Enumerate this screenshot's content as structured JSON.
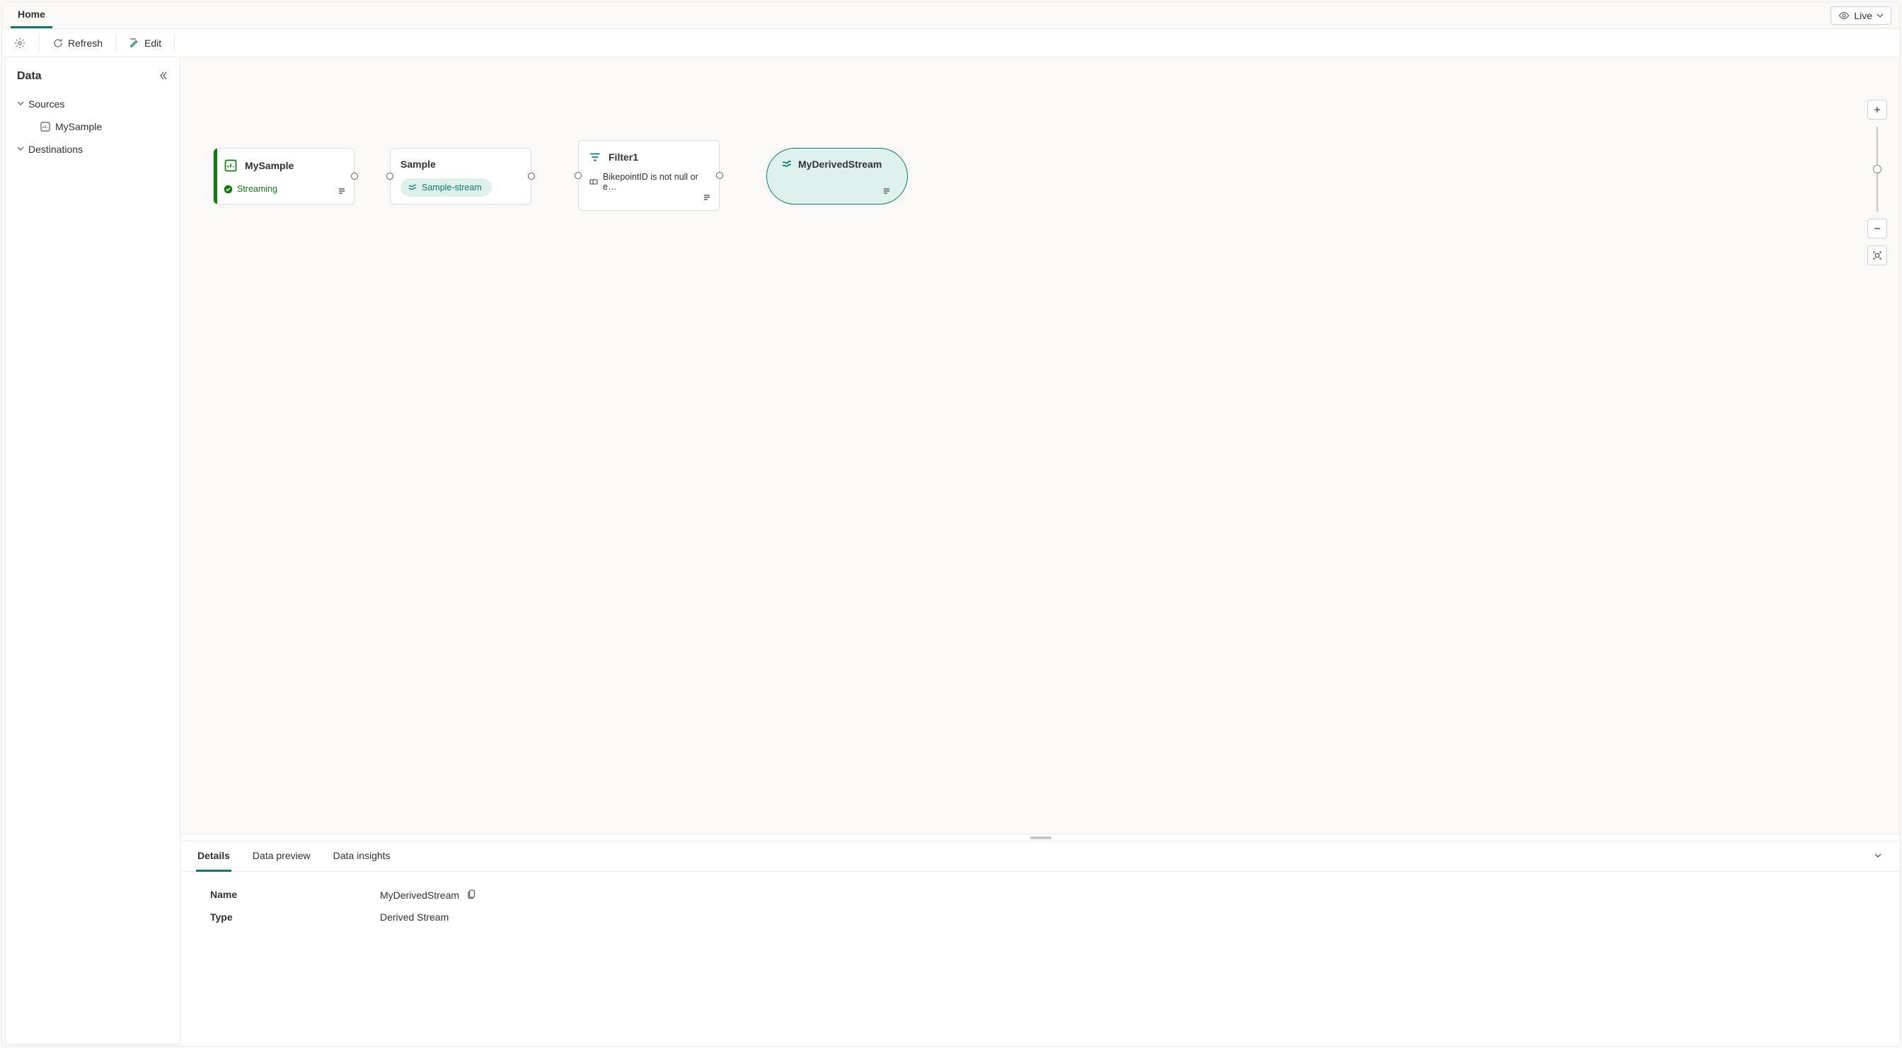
{
  "tabs": {
    "home": "Home"
  },
  "live_button": {
    "label": "Live"
  },
  "toolbar": {
    "refresh": "Refresh",
    "edit": "Edit"
  },
  "sidebar": {
    "title": "Data",
    "sources_label": "Sources",
    "destinations_label": "Destinations",
    "sources": [
      {
        "name": "MySample"
      }
    ]
  },
  "nodes": {
    "source": {
      "title": "MySample",
      "status": "Streaming"
    },
    "sample": {
      "title": "Sample",
      "chip": "Sample-stream"
    },
    "filter": {
      "title": "Filter1",
      "detail": "BikepointID is not null or e…"
    },
    "derived": {
      "title": "MyDerivedStream"
    }
  },
  "bottom": {
    "tabs": [
      "Details",
      "Data preview",
      "Data insights"
    ],
    "details": {
      "name_label": "Name",
      "name_value": "MyDerivedStream",
      "type_label": "Type",
      "type_value": "Derived Stream"
    }
  }
}
